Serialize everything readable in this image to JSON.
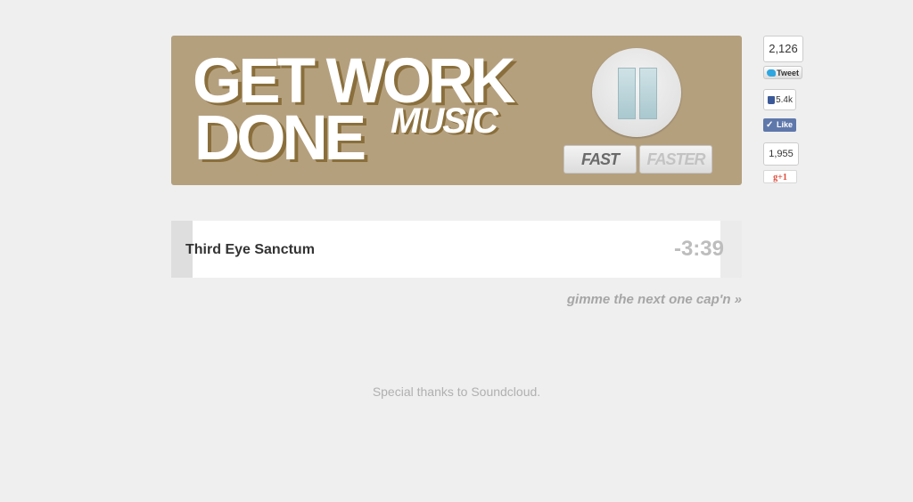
{
  "banner": {
    "title_line1": "GET WORK",
    "title_line2": "DONE",
    "title_music": "MUSIC",
    "background_color": "#b5a07e",
    "pause_icon": "pause-icon",
    "speed_fast": "FAST",
    "speed_faster": "FASTER"
  },
  "social": {
    "tweet_count": "2,126",
    "tweet_label": "Tweet",
    "like_count": "5.4k",
    "like_label": "Like",
    "plusone_count": "1,955",
    "plusone_label": "g+1"
  },
  "player": {
    "track_title": "Third Eye Sanctum",
    "time_remaining": "-3:39"
  },
  "next_link": "gimme the next one cap'n »",
  "footer": "Special thanks to Soundcloud."
}
